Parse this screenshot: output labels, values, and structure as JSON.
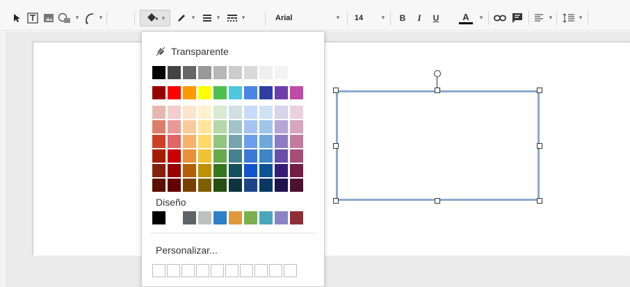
{
  "toolbar": {
    "tools": [
      {
        "icon": "select-arrow-icon"
      },
      {
        "icon": "text-box-icon"
      },
      {
        "icon": "image-icon"
      },
      {
        "icon": "shape-icon"
      },
      {
        "icon": "line-icon"
      },
      {
        "icon": "fill-color-icon"
      },
      {
        "icon": "border-color-icon"
      },
      {
        "icon": "border-weight-icon"
      },
      {
        "icon": "border-dash-icon"
      }
    ],
    "font_family": "Arial",
    "font_size": "14",
    "bold": "B",
    "italic": "I",
    "underline": "U",
    "text_color": "A",
    "text_color_value": "#000000"
  },
  "fill_menu": {
    "transparent_label": "Transparente",
    "design_label": "Diseño",
    "custom_label": "Personalizar...",
    "grays": [
      "#000000",
      "#434343",
      "#666666",
      "#999999",
      "#b7b7b7",
      "#cccccc",
      "#d9d9d9",
      "#efefef",
      "#f3f3f3",
      "#ffffff"
    ],
    "bright": [
      "#980000",
      "#ff0000",
      "#ff9900",
      "#ffff00",
      "#4fbf4f",
      "#4dc8e0",
      "#4a86e8",
      "#2d3fa0",
      "#6d3fa8",
      "#c04aa8"
    ],
    "shades": [
      [
        "#e6b8af",
        "#f4cccc",
        "#fce5cd",
        "#fff2cc",
        "#d9ead3",
        "#d0e0e3",
        "#c9daf8",
        "#cfe2f3",
        "#d9d2e9",
        "#ead1dc"
      ],
      [
        "#dd7e6b",
        "#ea9999",
        "#f9cb9c",
        "#ffe599",
        "#b6d7a8",
        "#a2c4c9",
        "#a4c2f4",
        "#9fc5e8",
        "#b4a7d6",
        "#d5a6bd"
      ],
      [
        "#cc4125",
        "#e06666",
        "#f6b26b",
        "#ffd966",
        "#93c47d",
        "#76a5af",
        "#6d9eeb",
        "#6fa8dc",
        "#8e7cc3",
        "#c27ba0"
      ],
      [
        "#a61c00",
        "#cc0000",
        "#e69138",
        "#f1c232",
        "#6aa84f",
        "#45818e",
        "#3c78d8",
        "#3d85c6",
        "#674ea7",
        "#a64d79"
      ],
      [
        "#85200c",
        "#990000",
        "#b45f06",
        "#bf9000",
        "#38761d",
        "#134f5c",
        "#1155cc",
        "#0b5394",
        "#351c75",
        "#741b47"
      ],
      [
        "#5b0f00",
        "#660000",
        "#783f04",
        "#7f6000",
        "#274e13",
        "#0c343d",
        "#1c4587",
        "#073763",
        "#20124d",
        "#4c1130"
      ]
    ],
    "design": [
      "#000000",
      "#ffffff",
      "#5f6368",
      "#c0c0c0",
      "#2e7fc8",
      "#e0983c",
      "#7ab04f",
      "#4aa6b8",
      "#8a84c4",
      "#8e2f37"
    ]
  }
}
